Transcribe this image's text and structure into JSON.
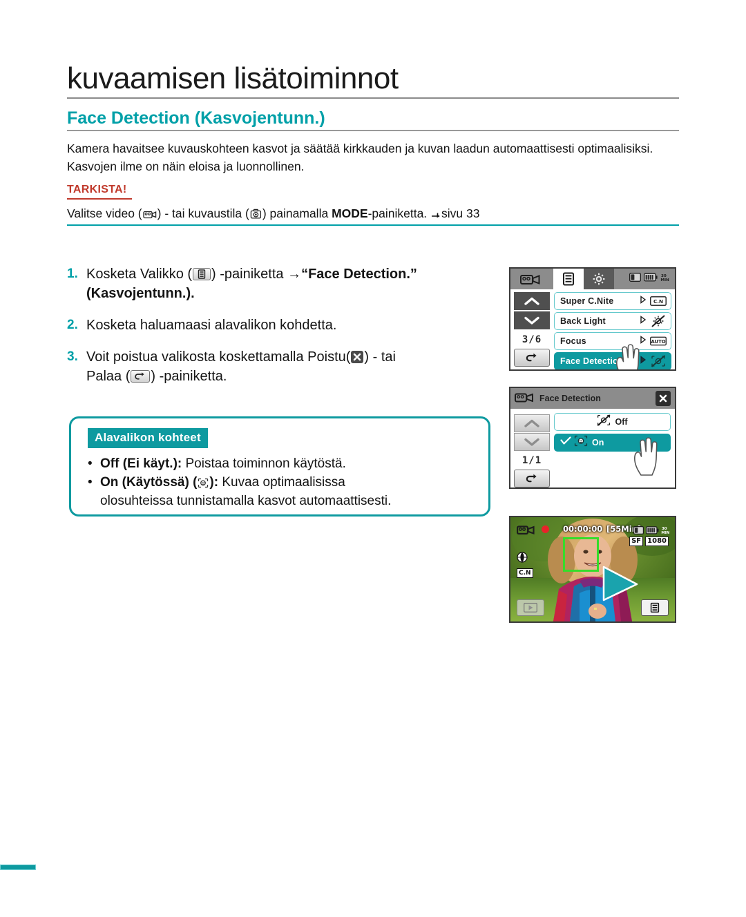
{
  "document": {
    "chapter_title": "kuvaamisen lisätoiminnot",
    "section_title": "Face Detection (Kasvojentunn.)",
    "intro": "Kamera havaitsee kuvauskohteen kasvot ja säätää kirkkauden ja kuvan laadun automaattisesti optimaalisiksi. Kasvojen ilme on näin eloisa ja luonnollinen.",
    "check": {
      "label": "TARKISTA!",
      "before_video_icon": "Valitse video (",
      "between_icons": ") - tai kuvaustila (",
      "after_icons": ") painamalla ",
      "mode_bold": "MODE",
      "tail": "-painiketta. ",
      "page_ref": "sivu 33"
    }
  },
  "steps": [
    {
      "num": "1.",
      "part1": "Kosketa Valikko (",
      "part2": ") -painiketta ",
      "arrow": "→",
      "bold1": "“Face Detection.”",
      "bold2": "(Kasvojentunn.)."
    },
    {
      "num": "2.",
      "part1": "Kosketa haluamaasi alavalikon kohdetta."
    },
    {
      "num": "3.",
      "part1": "Voit poistua valikosta koskettamalla Poistu(",
      "part2": ") - tai",
      "part3": "Palaa (",
      "part4": ") -painiketta."
    }
  ],
  "callout": {
    "badge": "Alavalikon kohteet",
    "items": [
      {
        "bullet": "•",
        "bold": "Off (Ei käyt.):",
        "text": " Poistaa toiminnon käytöstä."
      },
      {
        "bullet": "•",
        "bold": "On (Käytössä) (",
        "bold_tail": "):",
        "text": " Kuvaa optimaalisissa",
        "text2": "olosuhteissa tunnistamalla kasvot automaattisesti."
      }
    ]
  },
  "lcd_menu": {
    "page_indicator": "3/6",
    "rows": [
      {
        "label": "Super C.Nite",
        "value_icon": "c-nite-icon",
        "value_text": "C.N",
        "selected": false
      },
      {
        "label": "Back Light",
        "value_icon": "backlight-off-icon",
        "value_text": "",
        "selected": false
      },
      {
        "label": "Focus",
        "value_icon": "auto-icon",
        "value_text": "AUTO",
        "selected": false
      },
      {
        "label": "Face Detection",
        "value_icon": "face-detection-off-icon",
        "value_text": "",
        "selected": true
      }
    ]
  },
  "lcd_submenu": {
    "title": "Face Detection",
    "page_indicator": "1/1",
    "rows": [
      {
        "label": "Off",
        "selected": false,
        "checked": false
      },
      {
        "label": "On",
        "selected": true,
        "checked": true
      }
    ]
  },
  "lcd_preview": {
    "timecode": "00:00:00",
    "remaining": "[55Min]",
    "min_badge": "30 MIN",
    "quality": "SF",
    "resolution": "1080",
    "cnite": "C.N"
  },
  "colors": {
    "accent_teal": "#00a0a8",
    "callout_teal": "#0e9aa0",
    "check_red": "#c0392b",
    "face_box_green": "#35dd2a"
  }
}
